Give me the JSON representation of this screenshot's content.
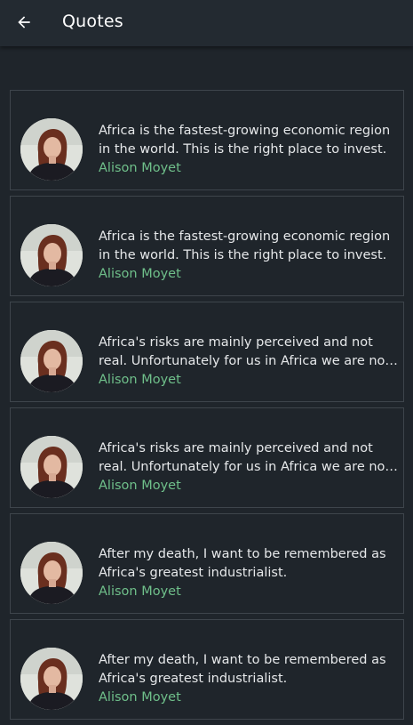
{
  "header": {
    "title": "Quotes",
    "back_icon": "arrow-back-icon"
  },
  "quotes": [
    {
      "text": "Africa is the fastest-growing economic region in the world. This is the right place to invest.",
      "author": "Alison Moyet"
    },
    {
      "text": "Africa is the fastest-growing economic region in the world. This is the right place to invest.",
      "author": "Alison Moyet"
    },
    {
      "text": "Africa's risks are mainly perceived and not real. Unfortunately for us in Africa we are not really very good at marketing ourselves.",
      "author": "Alison Moyet"
    },
    {
      "text": "Africa's risks are mainly perceived and not real. Unfortunately for us in Africa we are not really very good at marketing ourselves.",
      "author": "Alison Moyet"
    },
    {
      "text": "After my death, I want to be remembered as Africa's greatest industrialist.",
      "author": "Alison Moyet"
    },
    {
      "text": "After my death, I want to be remembered as Africa's greatest industrialist.",
      "author": "Alison Moyet"
    }
  ],
  "colors": {
    "background": "#1f252b",
    "appbar": "#232a31",
    "card_border": "#3e454c",
    "quote_text": "#e6e8ea",
    "author_text": "#6fbf8a"
  }
}
